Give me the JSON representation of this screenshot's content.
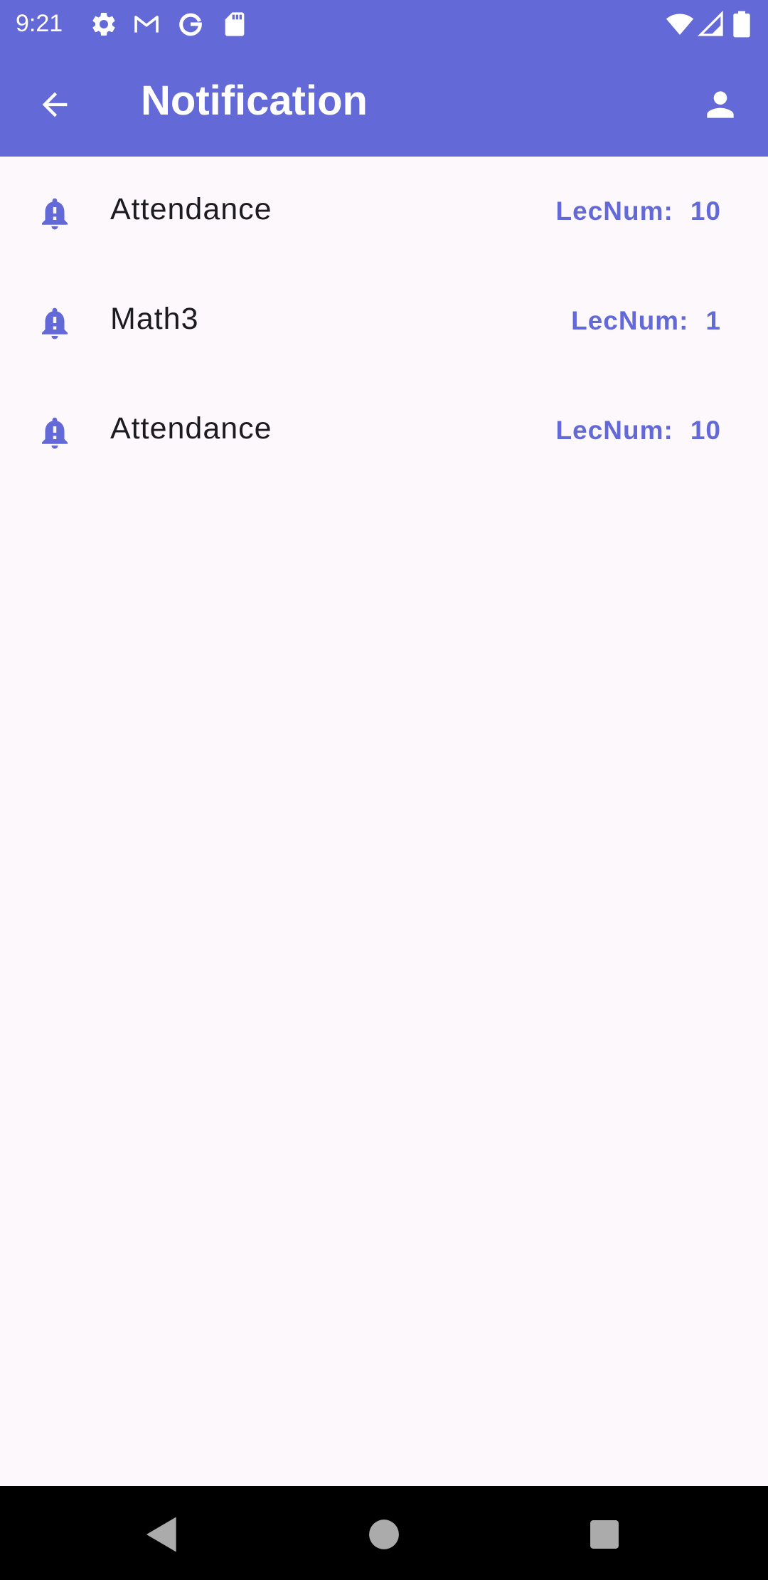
{
  "status_bar": {
    "time": "9:21",
    "left_icons": [
      "settings-icon",
      "gmail-icon",
      "google-icon",
      "sd-card-icon"
    ],
    "right_icons": [
      "wifi-icon",
      "signal-icon",
      "battery-icon"
    ]
  },
  "app_bar": {
    "title": "Notification",
    "back_icon": "arrow-back-icon",
    "profile_icon": "person-icon",
    "color": "#6469d8"
  },
  "notifications": [
    {
      "title": "Attendance",
      "lec_label": "LecNum:",
      "lec_value": "10",
      "icon": "bell-alert-icon"
    },
    {
      "title": "Math3",
      "lec_label": "LecNum:",
      "lec_value": "1",
      "icon": "bell-alert-icon"
    },
    {
      "title": "Attendance",
      "lec_label": "LecNum:",
      "lec_value": "10",
      "icon": "bell-alert-icon"
    }
  ],
  "nav_bar": {
    "buttons": [
      "back-triangle-icon",
      "home-circle-icon",
      "recents-square-icon"
    ]
  },
  "colors": {
    "accent": "#6469d8",
    "background": "#fdf8fc",
    "text": "#1c1b1f"
  }
}
